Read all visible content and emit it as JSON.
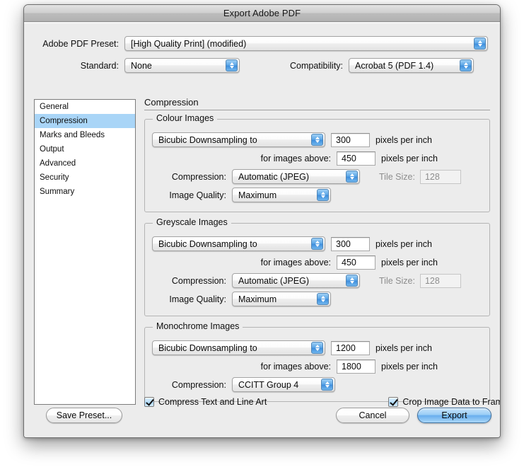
{
  "window": {
    "title": "Export Adobe PDF"
  },
  "header": {
    "preset_label": "Adobe PDF Preset:",
    "preset_value": "[High Quality Print] (modified)",
    "standard_label": "Standard:",
    "standard_value": "None",
    "compatibility_label": "Compatibility:",
    "compatibility_value": "Acrobat 5 (PDF 1.4)"
  },
  "sidebar": {
    "items": [
      {
        "label": "General",
        "selected": false
      },
      {
        "label": "Compression",
        "selected": true
      },
      {
        "label": "Marks and Bleeds",
        "selected": false
      },
      {
        "label": "Output",
        "selected": false
      },
      {
        "label": "Advanced",
        "selected": false
      },
      {
        "label": "Security",
        "selected": false
      },
      {
        "label": "Summary",
        "selected": false
      }
    ]
  },
  "panel": {
    "title": "Compression",
    "colour": {
      "legend": "Colour Images",
      "downsample_value": "Bicubic Downsampling to",
      "dpi_value": "300",
      "dpi_units": "pixels per inch",
      "above_label": "for images above:",
      "above_value": "450",
      "above_units": "pixels per inch",
      "compression_label": "Compression:",
      "compression_value": "Automatic (JPEG)",
      "tile_label": "Tile Size:",
      "tile_value": "128",
      "quality_label": "Image Quality:",
      "quality_value": "Maximum"
    },
    "greyscale": {
      "legend": "Greyscale Images",
      "downsample_value": "Bicubic Downsampling to",
      "dpi_value": "300",
      "dpi_units": "pixels per inch",
      "above_label": "for images above:",
      "above_value": "450",
      "above_units": "pixels per inch",
      "compression_label": "Compression:",
      "compression_value": "Automatic (JPEG)",
      "tile_label": "Tile Size:",
      "tile_value": "128",
      "quality_label": "Image Quality:",
      "quality_value": "Maximum"
    },
    "monochrome": {
      "legend": "Monochrome Images",
      "downsample_value": "Bicubic Downsampling to",
      "dpi_value": "1200",
      "dpi_units": "pixels per inch",
      "above_label": "for images above:",
      "above_value": "1800",
      "above_units": "pixels per inch",
      "compression_label": "Compression:",
      "compression_value": "CCITT Group 4"
    }
  },
  "checkboxes": {
    "compress_text_label": "Compress Text and Line Art",
    "crop_image_label": "Crop Image Data to Frames"
  },
  "footer": {
    "save_preset_label": "Save Preset...",
    "cancel_label": "Cancel",
    "export_label": "Export"
  },
  "colors": {
    "selection_blue": "#a9d5f7",
    "default_button_blue": "#68aeee",
    "window_chrome": "#ececec"
  }
}
